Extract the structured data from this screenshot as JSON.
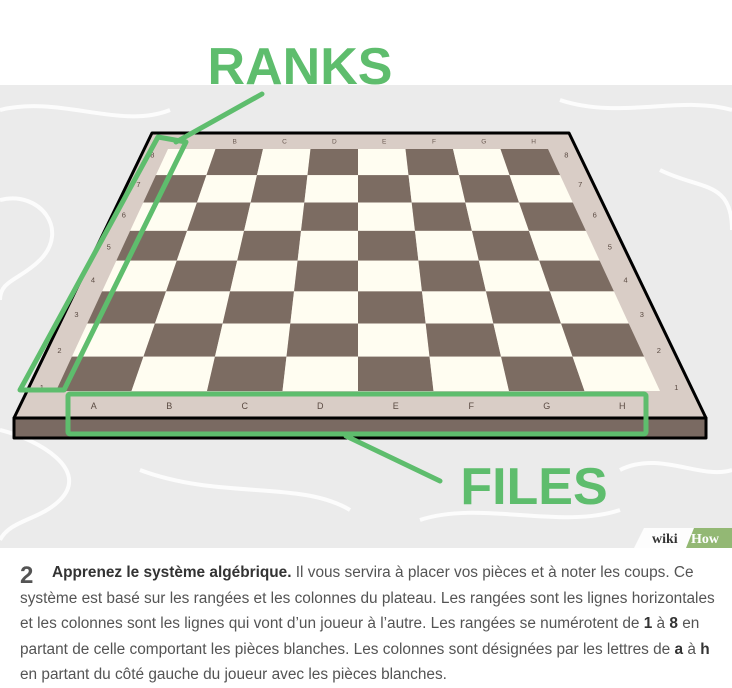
{
  "illustration": {
    "label_ranks": "RANKS",
    "label_files": "FILES",
    "files": [
      "A",
      "B",
      "C",
      "D",
      "E",
      "F",
      "G",
      "H"
    ],
    "ranks": [
      "8",
      "7",
      "6",
      "5",
      "4",
      "3",
      "2",
      "1"
    ],
    "colors": {
      "accent": "#5ebd6d",
      "dark_square": "#7c6c62",
      "light_square": "#fffdf1",
      "border": "#d9cdc6",
      "board_side": "#7a6a62",
      "background": "#ebebeb"
    }
  },
  "brand": {
    "part1": "wiki",
    "part2": "How"
  },
  "step": {
    "number": "2",
    "heading": "Apprenez le système algébrique.",
    "text_1": " Il vous servira à placer vos pièces et à noter les coups. Ce système est basé sur les rangées et les colonnes du plateau. Les rangées sont les lignes horizontales et les colonnes sont les lignes qui vont d’un joueur à l’autre. Les rangées se numérotent de ",
    "rank_low": "1",
    "text_2": " à ",
    "rank_high": "8",
    "text_3": " en partant de celle comportant les pièces blanches. Les colonnes sont désignées par les lettres de ",
    "file_low": "a",
    "text_4": " à ",
    "file_high": "h",
    "text_5": " en partant du côté gauche du joueur avec les pièces blanches."
  }
}
